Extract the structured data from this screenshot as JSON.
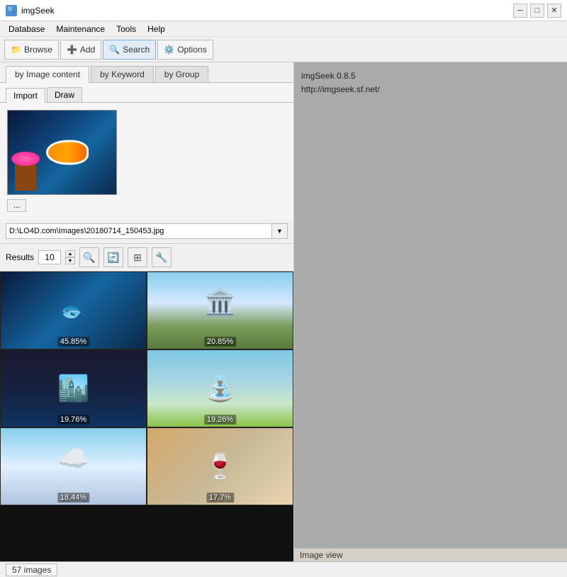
{
  "window": {
    "title": "imgSeek"
  },
  "titlebar": {
    "minimize": "─",
    "maximize": "□",
    "close": "✕"
  },
  "menubar": {
    "items": [
      "Database",
      "Maintenance",
      "Tools",
      "Help"
    ]
  },
  "toolbar": {
    "browse_label": "Browse",
    "add_label": "Add",
    "search_label": "Search",
    "options_label": "Options"
  },
  "main_tabs": {
    "by_image_content": "by Image content",
    "by_keyword": "by Keyword",
    "by_group": "by Group"
  },
  "sub_tabs": {
    "import": "Import",
    "draw": "Draw"
  },
  "image_preview": {
    "browse_btn": "...",
    "file_path": "D:\\LO4D.com\\Images\\20180714_150453.jpg"
  },
  "results_toolbar": {
    "results_label": "Results",
    "results_count": "10",
    "spin_up": "▲",
    "spin_down": "▼"
  },
  "result_items": [
    {
      "id": 1,
      "pct": "45.85%",
      "type": "fish"
    },
    {
      "id": 2,
      "pct": "20.85%",
      "type": "building"
    },
    {
      "id": 3,
      "pct": "19.76%",
      "type": "nightbuilding"
    },
    {
      "id": 4,
      "pct": "19.26%",
      "type": "fountain"
    },
    {
      "id": 5,
      "pct": "18.44%",
      "type": "clouds"
    },
    {
      "id": 6,
      "pct": "17.7%",
      "type": "wine"
    }
  ],
  "right_panel": {
    "app_name": "imgSeek 0.8.5",
    "app_url": "http://imgseek.sf.net/",
    "view_label": "Image view"
  },
  "statusbar": {
    "images_count": "57 images"
  }
}
